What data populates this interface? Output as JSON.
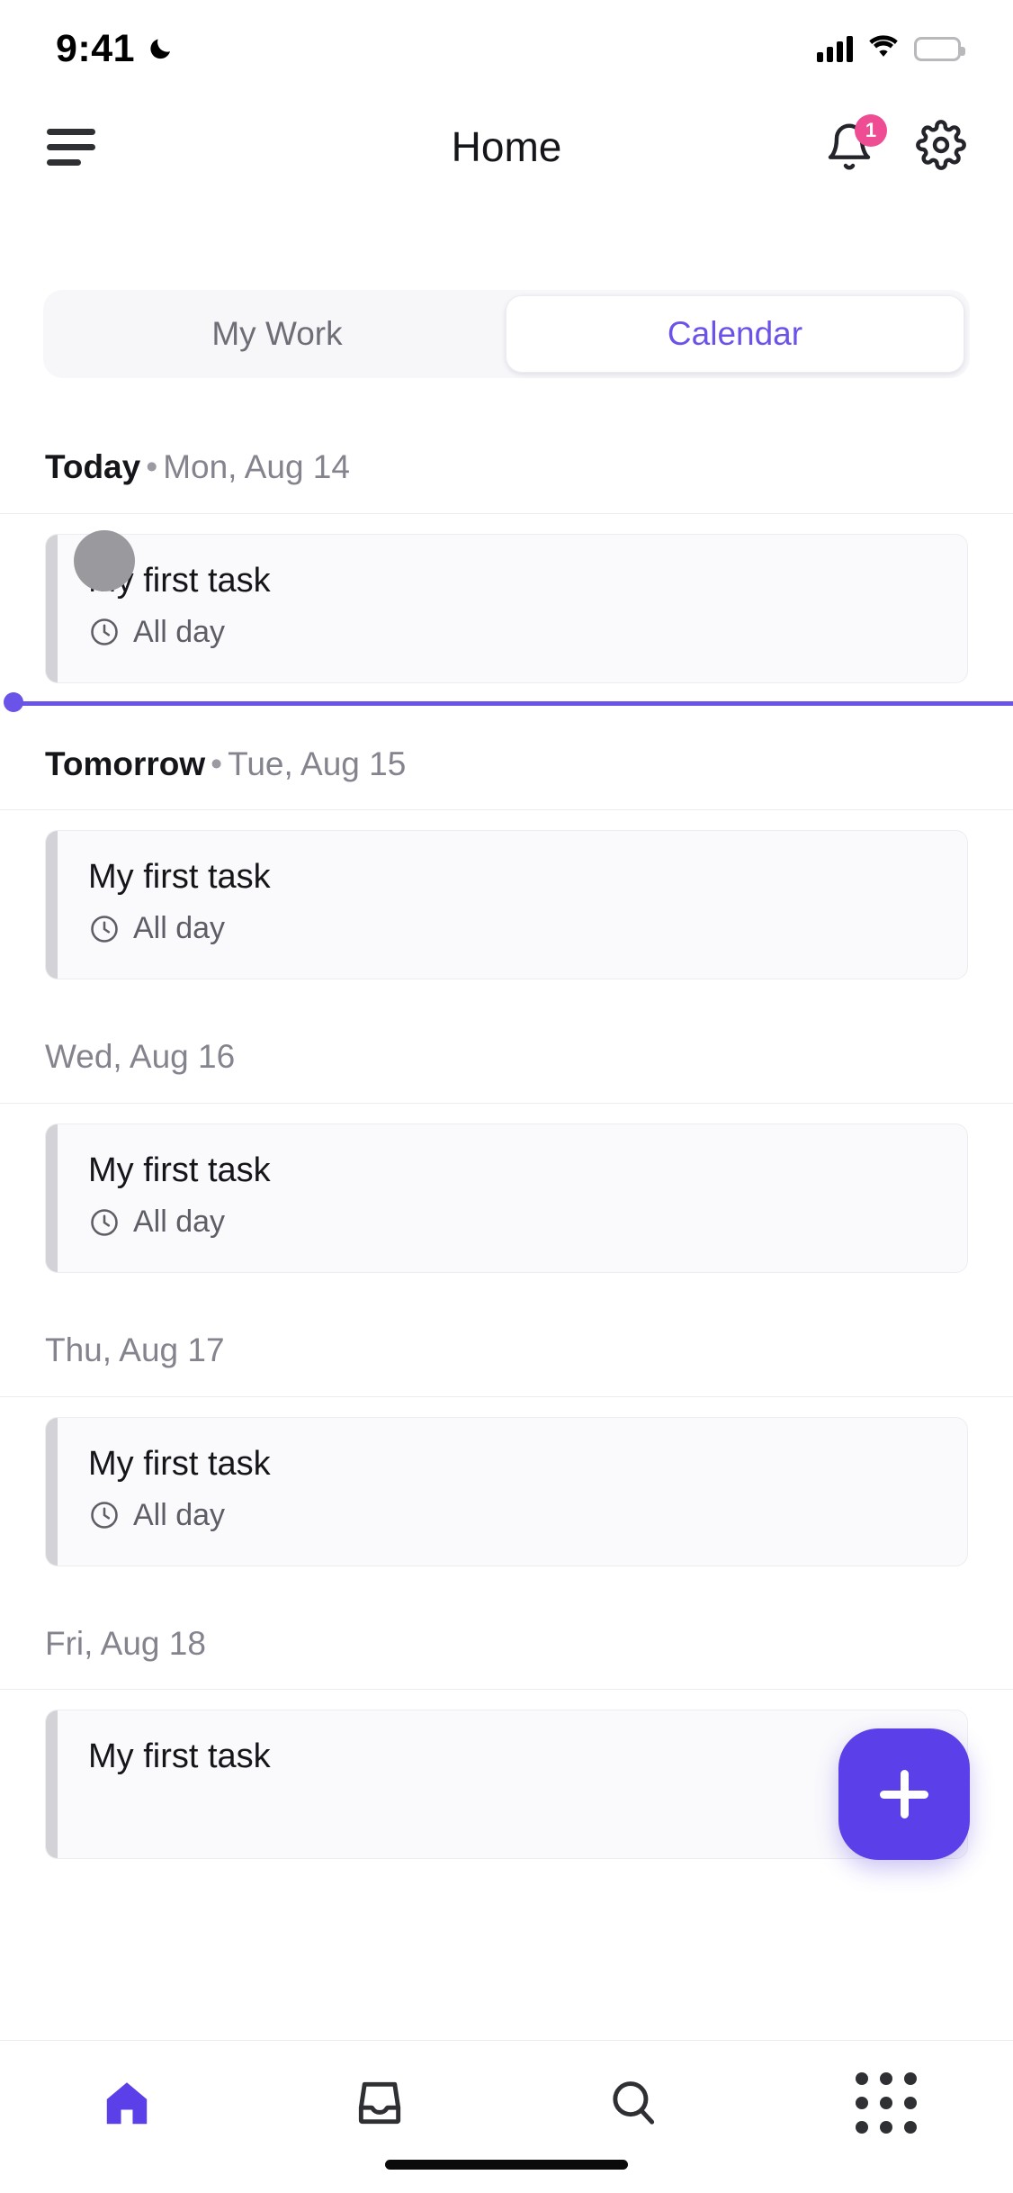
{
  "status_bar": {
    "time": "9:41",
    "moon_icon": "crescent-moon-icon",
    "signal_icon": "cellular-signal-icon",
    "wifi_icon": "wifi-icon",
    "battery_icon": "battery-full-icon"
  },
  "header": {
    "menu_icon": "hamburger-menu-icon",
    "title": "Home",
    "notifications_icon": "bell-icon",
    "notifications_badge": "1",
    "settings_icon": "gear-icon",
    "badge_color": "#ef4d93"
  },
  "segmented_control": {
    "tabs": [
      {
        "label": "My Work",
        "active": false
      },
      {
        "label": "Calendar",
        "active": true
      }
    ],
    "active_color": "#6a53e8",
    "inactive_color": "#6d6e76",
    "track_color": "#f7f7fa"
  },
  "calendar": {
    "now_indicator_color": "#6a53e8",
    "card_accent_color": "#d2d2d7",
    "groups": [
      {
        "label": "Today",
        "separator": "•",
        "date": "Mon, Aug 14",
        "emphasis": true,
        "show_now_line": true,
        "tasks": [
          {
            "title": "My first task",
            "time_icon": "clock-icon",
            "time": "All day",
            "has_avatar": true
          }
        ]
      },
      {
        "label": "Tomorrow",
        "separator": "•",
        "date": "Tue, Aug 15",
        "emphasis": true,
        "show_now_line": false,
        "tasks": [
          {
            "title": "My first task",
            "time_icon": "clock-icon",
            "time": "All day",
            "has_avatar": false
          }
        ]
      },
      {
        "label": "",
        "separator": "",
        "date": "Wed, Aug 16",
        "emphasis": false,
        "show_now_line": false,
        "tasks": [
          {
            "title": "My first task",
            "time_icon": "clock-icon",
            "time": "All day",
            "has_avatar": false
          }
        ]
      },
      {
        "label": "",
        "separator": "",
        "date": "Thu, Aug 17",
        "emphasis": false,
        "show_now_line": false,
        "tasks": [
          {
            "title": "My first task",
            "time_icon": "clock-icon",
            "time": "All day",
            "has_avatar": false
          }
        ]
      },
      {
        "label": "",
        "separator": "",
        "date": "Fri, Aug 18",
        "emphasis": false,
        "show_now_line": false,
        "tasks": [
          {
            "title": "My first task",
            "time_icon": "clock-icon",
            "time": "",
            "has_avatar": false
          }
        ]
      }
    ]
  },
  "fab": {
    "icon": "plus-icon",
    "color": "#5b3fe8"
  },
  "bottom_nav": {
    "active_color": "#5b3fe8",
    "inactive_color": "#2f3033",
    "items": [
      {
        "name": "home",
        "icon": "home-icon",
        "active": true
      },
      {
        "name": "inbox",
        "icon": "inbox-tray-icon",
        "active": false
      },
      {
        "name": "search",
        "icon": "search-icon",
        "active": false
      },
      {
        "name": "apps",
        "icon": "grid-dots-icon",
        "active": false
      }
    ]
  }
}
